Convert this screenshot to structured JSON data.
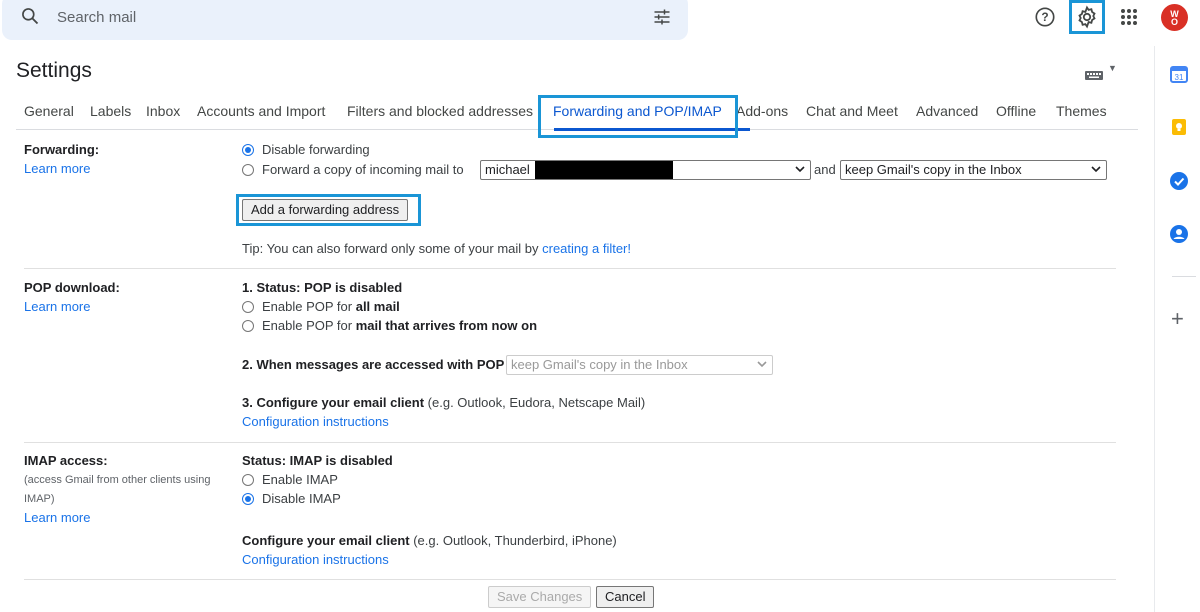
{
  "search": {
    "placeholder": "Search mail"
  },
  "header": {
    "help_icon": "help-circle-icon",
    "settings_icon": "gear-icon",
    "apps_icon": "apps-grid-icon",
    "avatar_text_top": "W",
    "avatar_text_bottom": "O"
  },
  "page": {
    "title": "Settings"
  },
  "tabs": [
    {
      "label": "General"
    },
    {
      "label": "Labels"
    },
    {
      "label": "Inbox"
    },
    {
      "label": "Accounts and Import"
    },
    {
      "label": "Filters and blocked addresses"
    },
    {
      "label": "Forwarding and POP/IMAP",
      "active": true
    },
    {
      "label": "Add-ons"
    },
    {
      "label": "Chat and Meet"
    },
    {
      "label": "Advanced"
    },
    {
      "label": "Offline"
    },
    {
      "label": "Themes"
    }
  ],
  "forwarding": {
    "label": "Forwarding:",
    "learn_more": "Learn more",
    "opt_disable": "Disable forwarding",
    "opt_forward": "Forward a copy of incoming mail to",
    "address_value": "michael",
    "and_text": "and",
    "keep_value": "keep Gmail's copy in the Inbox",
    "add_button": "Add a forwarding address",
    "tip_prefix": "Tip: You can also forward only some of your mail by",
    "tip_link": "creating a filter!"
  },
  "pop": {
    "label": "POP download:",
    "learn_more": "Learn more",
    "status": "1. Status: POP is disabled",
    "opt_all_prefix": "Enable POP for",
    "opt_all_bold": "all mail",
    "opt_now_prefix": "Enable POP for",
    "opt_now_bold": "mail that arrives from now on",
    "accessed_label": "2. When messages are accessed with POP",
    "accessed_value": "keep Gmail's copy in the Inbox",
    "configure_bold": "3. Configure your email client",
    "configure_rest": "(e.g. Outlook, Eudora, Netscape Mail)",
    "config_link": "Configuration instructions"
  },
  "imap": {
    "label": "IMAP access:",
    "note": "(access Gmail from other clients using IMAP)",
    "learn_more": "Learn more",
    "status": "Status: IMAP is disabled",
    "opt_enable": "Enable IMAP",
    "opt_disable": "Disable IMAP",
    "configure_bold": "Configure your email client",
    "configure_rest": "(e.g. Outlook, Thunderbird, iPhone)",
    "config_link": "Configuration instructions"
  },
  "footer": {
    "save": "Save Changes",
    "cancel": "Cancel"
  },
  "colors": {
    "accent": "#0b57d0",
    "link": "#1a73e8",
    "highlight": "#1a95d6"
  }
}
